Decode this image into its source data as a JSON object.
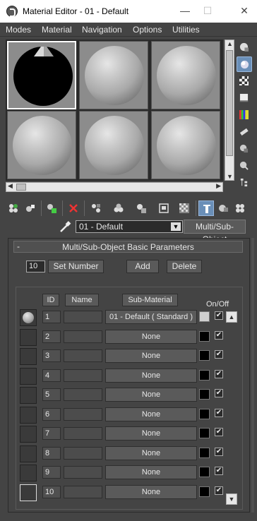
{
  "window": {
    "title": "Material Editor - 01 - Default",
    "min_glyph": "—",
    "max_glyph": "☐",
    "close_glyph": "✕"
  },
  "menu": [
    "Modes",
    "Material",
    "Navigation",
    "Options",
    "Utilities"
  ],
  "slots": {
    "count": 6,
    "active_index": 0,
    "arrow_left": "◀",
    "arrow_right": "▶",
    "arrow_up": "▲",
    "arrow_down": "▼"
  },
  "side_toolbar": [
    {
      "icon": "sample-type-icon",
      "active": false
    },
    {
      "icon": "backlight-icon",
      "active": true
    },
    {
      "icon": "background-checker-icon",
      "active": false
    },
    {
      "icon": "sample-uv-tiling-icon",
      "active": false
    },
    {
      "icon": "video-color-check-icon",
      "active": false
    },
    {
      "icon": "make-preview-icon",
      "active": false
    },
    {
      "icon": "options-icon",
      "active": false
    },
    {
      "icon": "select-by-material-icon",
      "active": false
    },
    {
      "icon": "material-map-navigator-icon",
      "active": false
    }
  ],
  "bottom_toolbar": [
    {
      "icon": "get-material-icon",
      "active": false
    },
    {
      "icon": "put-to-scene-icon",
      "active": false
    },
    {
      "icon": "assign-to-selection-icon",
      "active": false
    },
    {
      "icon": "reset-map-icon",
      "active": false
    },
    {
      "icon": "make-unique-icon",
      "active": false
    },
    {
      "icon": "put-to-library-icon",
      "active": false
    },
    {
      "icon": "material-id-channel-icon",
      "active": false
    },
    {
      "icon": "show-shaded-in-viewport-icon",
      "active": false
    },
    {
      "icon": "show-end-result-icon",
      "active": false
    },
    {
      "icon": "go-to-parent-icon",
      "active": true
    },
    {
      "icon": "go-forward-sibling-icon",
      "active": false
    },
    {
      "icon": "material-effects-icon",
      "active": false
    }
  ],
  "material": {
    "name": "01 - Default",
    "type": "Multi/Sub-Object",
    "dropdown_glyph": "▼"
  },
  "rollout": {
    "collapse_glyph": "-",
    "title": "Multi/Sub-Object Basic Parameters",
    "set_number_value": "10",
    "set_number_label": "Set Number",
    "add_label": "Add",
    "delete_label": "Delete",
    "headers": {
      "id": "ID",
      "name": "Name",
      "sub_material": "Sub-Material",
      "on_off": "On/Off"
    },
    "check_glyph": "✔",
    "scroll_up": "▲",
    "scroll_down": "▼"
  },
  "rows": [
    {
      "id": "1",
      "sub_material": "01 - Default  ( Standard )",
      "swatch": "#cfcfcf",
      "on": true,
      "has_preview": true
    },
    {
      "id": "2",
      "sub_material": "None",
      "swatch": "#000000",
      "on": true,
      "has_preview": false
    },
    {
      "id": "3",
      "sub_material": "None",
      "swatch": "#000000",
      "on": true,
      "has_preview": false
    },
    {
      "id": "4",
      "sub_material": "None",
      "swatch": "#000000",
      "on": true,
      "has_preview": false
    },
    {
      "id": "5",
      "sub_material": "None",
      "swatch": "#000000",
      "on": true,
      "has_preview": false
    },
    {
      "id": "6",
      "sub_material": "None",
      "swatch": "#000000",
      "on": true,
      "has_preview": false
    },
    {
      "id": "7",
      "sub_material": "None",
      "swatch": "#000000",
      "on": true,
      "has_preview": false
    },
    {
      "id": "8",
      "sub_material": "None",
      "swatch": "#000000",
      "on": true,
      "has_preview": false
    },
    {
      "id": "9",
      "sub_material": "None",
      "swatch": "#000000",
      "on": true,
      "has_preview": false
    },
    {
      "id": "10",
      "sub_material": "None",
      "swatch": "#000000",
      "on": true,
      "has_preview": false
    }
  ]
}
